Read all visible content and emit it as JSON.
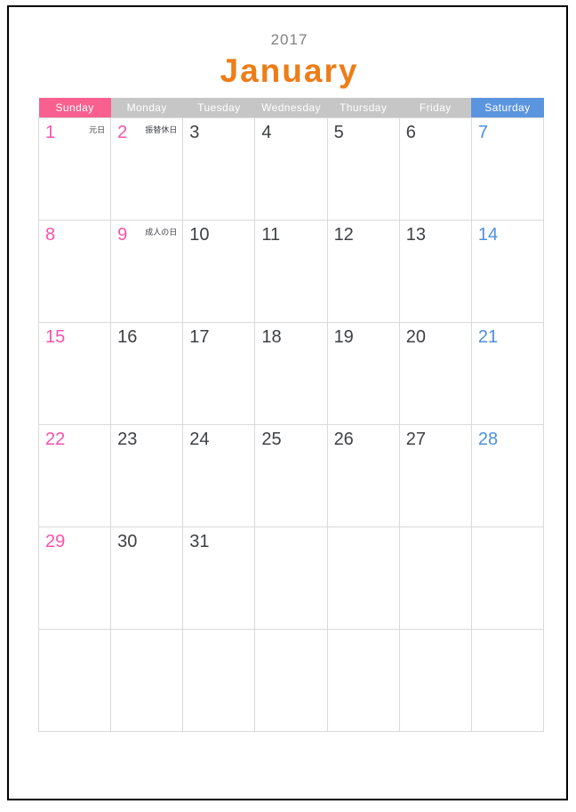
{
  "page": {
    "year": "2017",
    "month": "January"
  },
  "colors": {
    "month_title": "#ED7D18",
    "year_title": "#808080",
    "sunday_header_bg": "#F9608F",
    "saturday_header_bg": "#5B95DF",
    "weekday_header_bg": "#C6C6C6",
    "sunday_text": "#FA52AC",
    "saturday_text": "#4C8FE0",
    "weekday_text": "#3E4044",
    "grid_line": "#D9D9D9",
    "page_border": "#000000"
  },
  "weekdays": [
    {
      "label": "Sunday",
      "kind": "sun"
    },
    {
      "label": "Monday",
      "kind": "weekday"
    },
    {
      "label": "Tuesday",
      "kind": "weekday"
    },
    {
      "label": "Wednesday",
      "kind": "weekday"
    },
    {
      "label": "Thursday",
      "kind": "weekday"
    },
    {
      "label": "Friday",
      "kind": "weekday"
    },
    {
      "label": "Saturday",
      "kind": "sat"
    }
  ],
  "weeks": [
    [
      {
        "day": "1",
        "kind": "sun",
        "holiday": "元日"
      },
      {
        "day": "2",
        "kind": "sun",
        "holiday": "振替休日"
      },
      {
        "day": "3",
        "kind": "weekday",
        "holiday": ""
      },
      {
        "day": "4",
        "kind": "weekday",
        "holiday": ""
      },
      {
        "day": "5",
        "kind": "weekday",
        "holiday": ""
      },
      {
        "day": "6",
        "kind": "weekday",
        "holiday": ""
      },
      {
        "day": "7",
        "kind": "sat",
        "holiday": ""
      }
    ],
    [
      {
        "day": "8",
        "kind": "sun",
        "holiday": ""
      },
      {
        "day": "9",
        "kind": "sun",
        "holiday": "成人の日"
      },
      {
        "day": "10",
        "kind": "weekday",
        "holiday": ""
      },
      {
        "day": "11",
        "kind": "weekday",
        "holiday": ""
      },
      {
        "day": "12",
        "kind": "weekday",
        "holiday": ""
      },
      {
        "day": "13",
        "kind": "weekday",
        "holiday": ""
      },
      {
        "day": "14",
        "kind": "sat",
        "holiday": ""
      }
    ],
    [
      {
        "day": "15",
        "kind": "sun",
        "holiday": ""
      },
      {
        "day": "16",
        "kind": "weekday",
        "holiday": ""
      },
      {
        "day": "17",
        "kind": "weekday",
        "holiday": ""
      },
      {
        "day": "18",
        "kind": "weekday",
        "holiday": ""
      },
      {
        "day": "19",
        "kind": "weekday",
        "holiday": ""
      },
      {
        "day": "20",
        "kind": "weekday",
        "holiday": ""
      },
      {
        "day": "21",
        "kind": "sat",
        "holiday": ""
      }
    ],
    [
      {
        "day": "22",
        "kind": "sun",
        "holiday": ""
      },
      {
        "day": "23",
        "kind": "weekday",
        "holiday": ""
      },
      {
        "day": "24",
        "kind": "weekday",
        "holiday": ""
      },
      {
        "day": "25",
        "kind": "weekday",
        "holiday": ""
      },
      {
        "day": "26",
        "kind": "weekday",
        "holiday": ""
      },
      {
        "day": "27",
        "kind": "weekday",
        "holiday": ""
      },
      {
        "day": "28",
        "kind": "sat",
        "holiday": ""
      }
    ],
    [
      {
        "day": "29",
        "kind": "sun",
        "holiday": ""
      },
      {
        "day": "30",
        "kind": "weekday",
        "holiday": ""
      },
      {
        "day": "31",
        "kind": "weekday",
        "holiday": ""
      },
      {
        "day": "",
        "kind": "weekday",
        "holiday": ""
      },
      {
        "day": "",
        "kind": "weekday",
        "holiday": ""
      },
      {
        "day": "",
        "kind": "weekday",
        "holiday": ""
      },
      {
        "day": "",
        "kind": "sat",
        "holiday": ""
      }
    ],
    [
      {
        "day": "",
        "kind": "sun",
        "holiday": ""
      },
      {
        "day": "",
        "kind": "weekday",
        "holiday": ""
      },
      {
        "day": "",
        "kind": "weekday",
        "holiday": ""
      },
      {
        "day": "",
        "kind": "weekday",
        "holiday": ""
      },
      {
        "day": "",
        "kind": "weekday",
        "holiday": ""
      },
      {
        "day": "",
        "kind": "weekday",
        "holiday": ""
      },
      {
        "day": "",
        "kind": "sat",
        "holiday": ""
      }
    ]
  ]
}
